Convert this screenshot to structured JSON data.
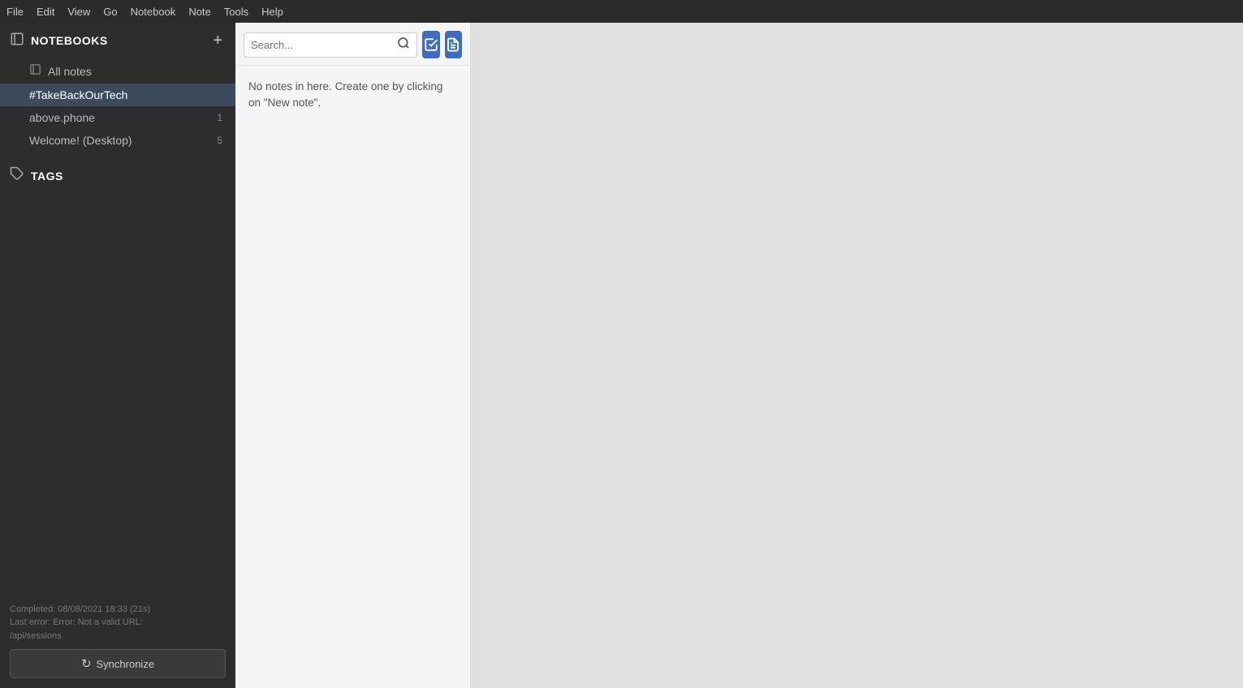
{
  "menubar": {
    "items": [
      "File",
      "Edit",
      "View",
      "Go",
      "Notebook",
      "Note",
      "Tools",
      "Help"
    ]
  },
  "sidebar": {
    "notebooks_title": "NOTEBOOKS",
    "notebooks_icon": "📓",
    "add_button_label": "+",
    "all_notes_label": "All notes",
    "notebooks": [
      {
        "label": "#TakeBackOurTech",
        "count": "",
        "active": true
      },
      {
        "label": "above.phone",
        "count": "1",
        "active": false
      },
      {
        "label": "Welcome! (Desktop)",
        "count": "5",
        "active": false
      }
    ],
    "tags_title": "TAGS",
    "tags_icon": "🏷",
    "status": {
      "completed": "Completed: 08/08/2021 18:33 (21s)",
      "last_error_line1": "Last error: Error: Not a valid URL:",
      "last_error_line2": "/api/sessions"
    },
    "sync_button_label": "Synchronize",
    "sync_icon": "↻"
  },
  "notes_panel": {
    "search_placeholder": "Search...",
    "search_icon": "🔍",
    "toolbar_btn1_icon": "✓",
    "toolbar_btn2_icon": "📝",
    "empty_message": "No notes in here. Create one by clicking on \"New note\"."
  },
  "colors": {
    "sidebar_bg": "#2d2d2d",
    "active_item_bg": "#3d4a5c",
    "toolbar_btn_bg": "#3d6cc0",
    "notes_panel_bg": "#f5f5f5",
    "editor_bg": "#e0e0e0"
  }
}
